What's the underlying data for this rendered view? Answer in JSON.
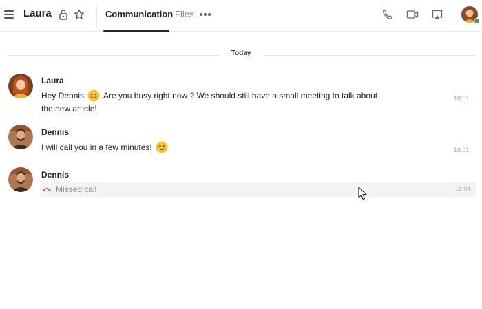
{
  "header": {
    "conversation_title": "Laura",
    "tabs": [
      {
        "label": "Communication",
        "active": true
      },
      {
        "label": "Files",
        "active": false
      }
    ],
    "icons": {
      "menu": "hamburger-icon",
      "lock": "lock-icon",
      "favorite": "star-icon",
      "more": "ellipsis-icon",
      "call": "phone-icon",
      "video": "video-camera-icon",
      "screen": "screen-share-icon"
    },
    "user_status_color": "#4c9a6a"
  },
  "date_separator": "Today",
  "messages": [
    {
      "author": "Laura",
      "text_parts": [
        "Hey Dennis",
        "Are you busy right now ? We should still have a small meeting to talk about",
        "the new article!"
      ],
      "emojis": [
        "slightly-smiling-face"
      ],
      "time": "18:01"
    },
    {
      "author": "Dennis",
      "text_parts": [
        "I will call you in a few minutes!"
      ],
      "emojis": [
        "winking-face"
      ],
      "time": "18:01"
    },
    {
      "author": "Dennis",
      "system_call": {
        "label": "Missed call",
        "icon": "phone-hangup-icon"
      },
      "time": "18:04"
    }
  ],
  "colors": {
    "accent": "#0f2d3d",
    "missed_call_icon": "#b5735a",
    "emoji": "#f5c33b"
  }
}
